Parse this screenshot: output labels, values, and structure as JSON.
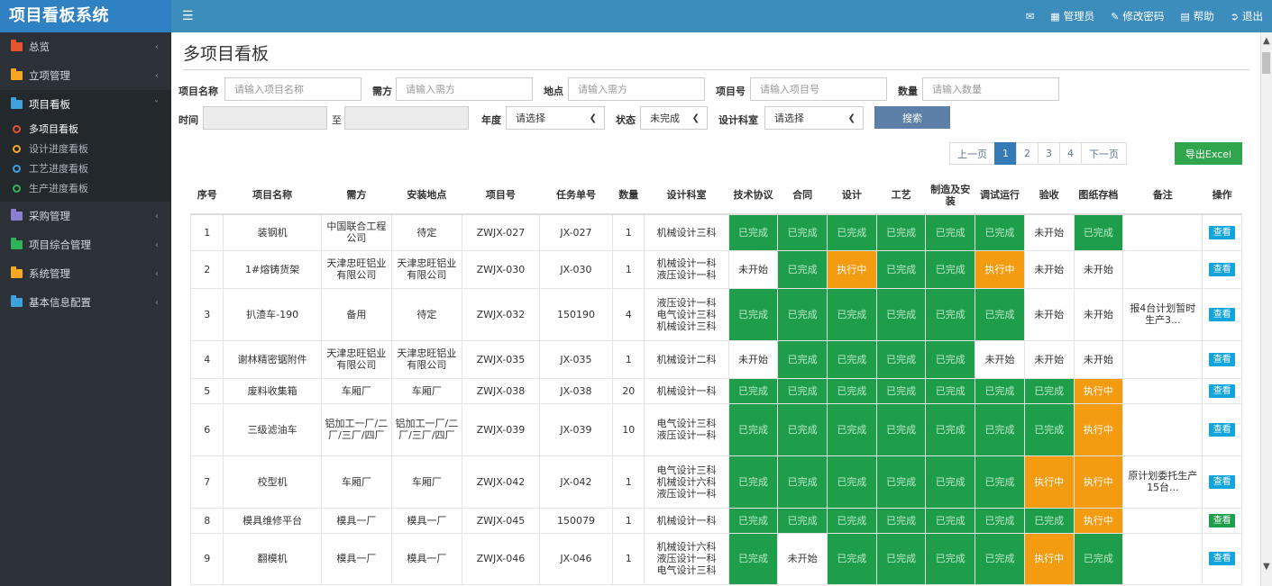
{
  "app": {
    "title": "项目看板系统"
  },
  "topbar": {
    "user": "管理员",
    "change_password": "修改密码",
    "help": "帮助",
    "logout": "退出"
  },
  "sidebar": {
    "items": [
      {
        "label": "总览",
        "color": "#e8532f"
      },
      {
        "label": "立项管理",
        "color": "#f5a623"
      },
      {
        "label": "项目看板",
        "color": "#3ea0dd"
      },
      {
        "label": "采购管理",
        "color": "#8a7fd1"
      },
      {
        "label": "项目综合管理",
        "color": "#2fb35a"
      },
      {
        "label": "系统管理",
        "color": "#f5a623"
      },
      {
        "label": "基本信息配置",
        "color": "#3ea0dd"
      }
    ],
    "submenu": [
      {
        "label": "多项目看板",
        "color": "#e8532f"
      },
      {
        "label": "设计进度看板",
        "color": "#f5a623"
      },
      {
        "label": "工艺进度看板",
        "color": "#3ea0dd"
      },
      {
        "label": "生产进度看板",
        "color": "#2fb35a"
      }
    ]
  },
  "page": {
    "title": "多项目看板"
  },
  "filters": {
    "name_label": "项目名称",
    "name_placeholder": "请输入项目名称",
    "demander_label": "需方",
    "demander_placeholder": "请输入需方",
    "location_label": "地点",
    "location_placeholder": "请输入需方",
    "projno_label": "项目号",
    "projno_placeholder": "请输入项目号",
    "qty_label": "数量",
    "qty_placeholder": "请输入数量",
    "time_label": "时间",
    "to_label": "至",
    "year_label": "年度",
    "year_value": "请选择",
    "status_label": "状态",
    "status_value": "未完成",
    "dept_label": "设计科室",
    "dept_value": "请选择",
    "search_button": "搜索"
  },
  "pagination": {
    "prev": "上一页",
    "pages": [
      "1",
      "2",
      "3",
      "4"
    ],
    "current": "1",
    "next": "下一页"
  },
  "export_button": "导出Excel",
  "table": {
    "headers": [
      "序号",
      "项目名称",
      "需方",
      "安装地点",
      "项目号",
      "任务单号",
      "数量",
      "设计科室",
      "技术协议",
      "合同",
      "设计",
      "工艺",
      "制造及安装",
      "调试运行",
      "验收",
      "图纸存档",
      "备注",
      "操作"
    ],
    "status_done": "已完成",
    "status_progress": "执行中",
    "status_notstarted": "未开始",
    "view_label": "查看",
    "rows": [
      {
        "no": "1",
        "name": "装钢机",
        "demander": "中国联合工程公司",
        "location": "待定",
        "proj": "ZWJX-027",
        "task": "JX-027",
        "qty": "1",
        "dept": "机械设计三科",
        "statuses": [
          "done",
          "done",
          "done",
          "done",
          "done",
          "done",
          "not",
          "done"
        ],
        "note": "",
        "btn": "blue"
      },
      {
        "no": "2",
        "name": "1#熔铸货架",
        "demander": "天津忠旺铝业有限公司",
        "location": "天津忠旺铝业有限公司",
        "proj": "ZWJX-030",
        "task": "JX-030",
        "qty": "1",
        "dept": "机械设计一科\n液压设计一科",
        "statuses": [
          "not",
          "done",
          "prog",
          "done",
          "done",
          "prog",
          "not",
          "not"
        ],
        "note": "",
        "btn": "blue"
      },
      {
        "no": "3",
        "name": "扒渣车-190",
        "demander": "备用",
        "location": "待定",
        "proj": "ZWJX-032",
        "task": "150190",
        "qty": "4",
        "dept": "液压设计一科\n电气设计三科\n机械设计三科",
        "statuses": [
          "done",
          "done",
          "done",
          "done",
          "done",
          "done",
          "not",
          "not"
        ],
        "note": "报4台计划暂时生产3...",
        "btn": "blue"
      },
      {
        "no": "4",
        "name": "谢林精密锯附件",
        "demander": "天津忠旺铝业有限公司",
        "location": "天津忠旺铝业有限公司",
        "proj": "ZWJX-035",
        "task": "JX-035",
        "qty": "1",
        "dept": "机械设计二科",
        "statuses": [
          "not",
          "done",
          "done",
          "done",
          "done",
          "not",
          "not",
          "not"
        ],
        "note": "",
        "btn": "blue"
      },
      {
        "no": "5",
        "name": "废料收集箱",
        "demander": "车厢厂",
        "location": "车厢厂",
        "proj": "ZWJX-038",
        "task": "JX-038",
        "qty": "20",
        "dept": "机械设计一科",
        "statuses": [
          "done",
          "done",
          "done",
          "done",
          "done",
          "done",
          "done",
          "prog"
        ],
        "note": "",
        "btn": "blue"
      },
      {
        "no": "6",
        "name": "三级滤油车",
        "demander": "铝加工一厂/二厂/三厂/四厂",
        "location": "铝加工一厂/二厂/三厂/四厂",
        "proj": "ZWJX-039",
        "task": "JX-039",
        "qty": "10",
        "dept": "电气设计三科\n液压设计一科",
        "statuses": [
          "done",
          "done",
          "done",
          "done",
          "done",
          "done",
          "done",
          "prog"
        ],
        "note": "",
        "btn": "blue"
      },
      {
        "no": "7",
        "name": "校型机",
        "demander": "车厢厂",
        "location": "车厢厂",
        "proj": "ZWJX-042",
        "task": "JX-042",
        "qty": "1",
        "dept": "电气设计三科\n机械设计六科\n液压设计一科",
        "statuses": [
          "done",
          "done",
          "done",
          "done",
          "done",
          "done",
          "prog",
          "prog"
        ],
        "note": "原计划委托生产15台...",
        "btn": "blue"
      },
      {
        "no": "8",
        "name": "模具维修平台",
        "demander": "模具一厂",
        "location": "模具一厂",
        "proj": "ZWJX-045",
        "task": "150079",
        "qty": "1",
        "dept": "机械设计一科",
        "statuses": [
          "done",
          "done",
          "done",
          "done",
          "done",
          "done",
          "done",
          "prog"
        ],
        "note": "",
        "btn": "green"
      },
      {
        "no": "9",
        "name": "翻模机",
        "demander": "模具一厂",
        "location": "模具一厂",
        "proj": "ZWJX-046",
        "task": "JX-046",
        "qty": "1",
        "dept": "机械设计六科\n液压设计一科\n电气设计三科",
        "statuses": [
          "done",
          "not",
          "done",
          "done",
          "done",
          "done",
          "prog",
          "done"
        ],
        "note": "",
        "btn": "blue"
      }
    ]
  }
}
